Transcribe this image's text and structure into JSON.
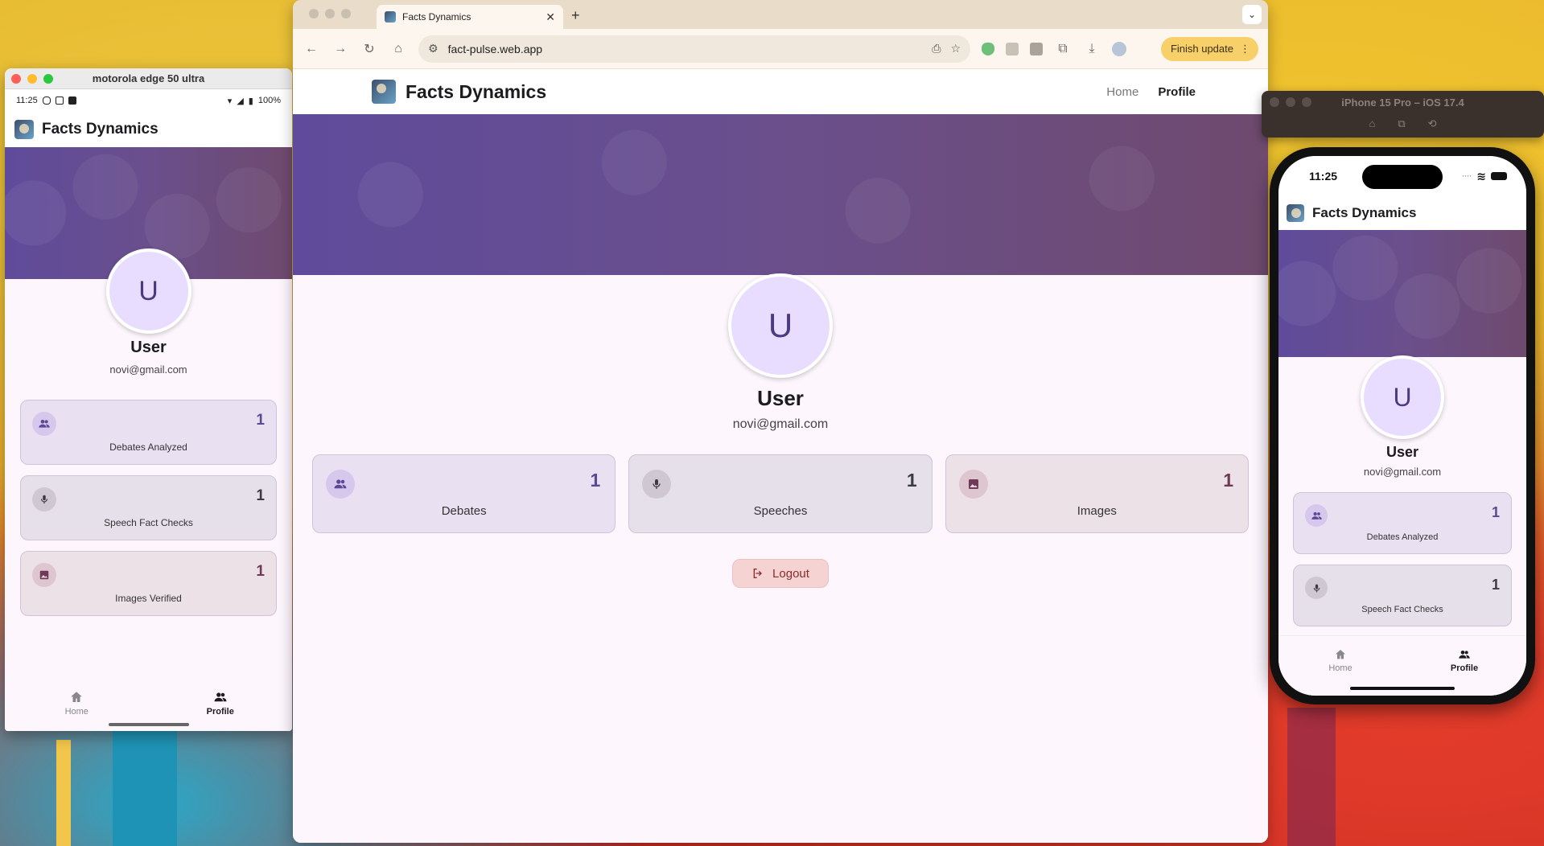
{
  "app": {
    "name": "Facts Dynamics",
    "user_initial": "U",
    "user_name": "User",
    "user_email": "novi@gmail.com"
  },
  "colors": {
    "banner_start": "#5f4b9b",
    "banner_end": "#6f4a6e",
    "avatar_bg": "#e9ddff",
    "page_bg": "#fdf6fd",
    "logout_bg": "#f6d3d3"
  },
  "android": {
    "window_title": "motorola edge 50 ultra",
    "time": "11:25",
    "battery": "100%",
    "stats": [
      {
        "label": "Debates Analyzed",
        "value": "1",
        "icon": "group-icon"
      },
      {
        "label": "Speech Fact Checks",
        "value": "1",
        "icon": "mic-icon"
      },
      {
        "label": "Images Verified",
        "value": "1",
        "icon": "image-icon"
      }
    ],
    "nav": {
      "home": "Home",
      "profile": "Profile"
    }
  },
  "browser": {
    "tab_title": "Facts Dynamics",
    "url": "fact-pulse.web.app",
    "update_label": "Finish update",
    "nav_links": {
      "home": "Home",
      "profile": "Profile"
    },
    "stats": [
      {
        "label": "Debates",
        "value": "1",
        "icon": "group-icon"
      },
      {
        "label": "Speeches",
        "value": "1",
        "icon": "mic-icon"
      },
      {
        "label": "Images",
        "value": "1",
        "icon": "image-icon"
      }
    ],
    "logout_label": "Logout"
  },
  "ios": {
    "window_title": "iPhone 15 Pro – iOS 17.4",
    "time": "11:25",
    "stats": [
      {
        "label": "Debates Analyzed",
        "value": "1",
        "icon": "group-icon"
      },
      {
        "label": "Speech Fact Checks",
        "value": "1",
        "icon": "mic-icon"
      }
    ],
    "nav": {
      "home": "Home",
      "profile": "Profile"
    }
  }
}
